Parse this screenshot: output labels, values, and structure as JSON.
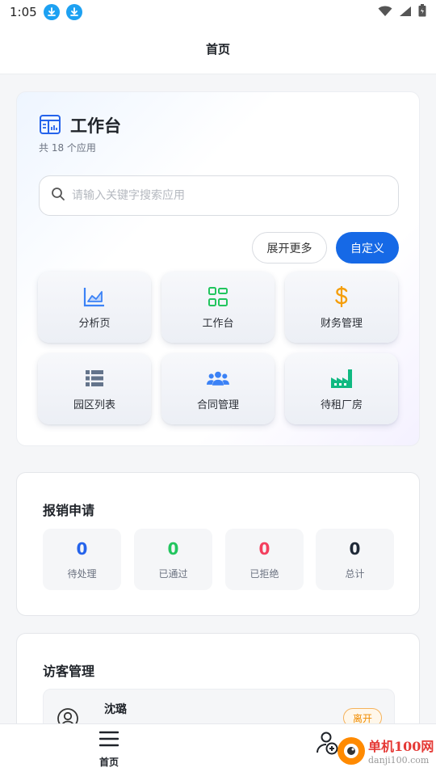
{
  "status_bar": {
    "time": "1:05"
  },
  "header": {
    "title": "首页"
  },
  "workspace": {
    "title": "工作台",
    "subtitle": "共 18 个应用",
    "search": {
      "placeholder": "请输入关键字搜索应用",
      "value": ""
    },
    "expand_label": "展开更多",
    "customize_label": "自定义",
    "apps": [
      {
        "label": "分析页",
        "icon": "chart-area-icon",
        "color": "#3b82f6"
      },
      {
        "label": "工作台",
        "icon": "grid-icon",
        "color": "#22c55e"
      },
      {
        "label": "财务管理",
        "icon": "dollar-icon",
        "color": "#f59e0b"
      },
      {
        "label": "园区列表",
        "icon": "list-icon",
        "color": "#64748b"
      },
      {
        "label": "合同管理",
        "icon": "users-icon",
        "color": "#3b82f6"
      },
      {
        "label": "待租厂房",
        "icon": "factory-icon",
        "color": "#10b981"
      }
    ]
  },
  "reimbursement": {
    "title": "报销申请",
    "stats": [
      {
        "value": "0",
        "label": "待处理",
        "color": "#2563eb"
      },
      {
        "value": "0",
        "label": "已通过",
        "color": "#22c55e"
      },
      {
        "value": "0",
        "label": "已拒绝",
        "color": "#f43f5e"
      },
      {
        "value": "0",
        "label": "总计",
        "color": "#1f2937"
      }
    ]
  },
  "visitors": {
    "title": "访客管理",
    "items": [
      {
        "name": "沈璐",
        "status": "离开"
      }
    ]
  },
  "bottom_nav": {
    "home_label": "首页"
  },
  "watermark": {
    "cn": "单机100网",
    "en": "danji100.com"
  }
}
